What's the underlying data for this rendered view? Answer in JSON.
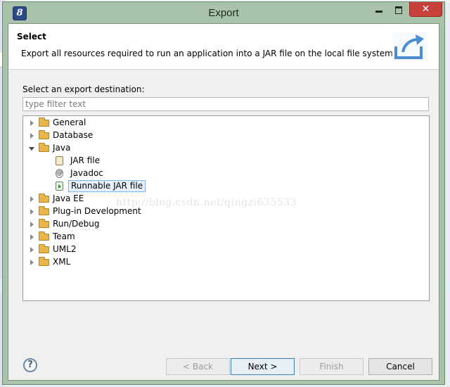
{
  "window": {
    "title": "Export",
    "close_glyph": "✕",
    "app_icon_glyph": "8"
  },
  "header": {
    "title": "Select",
    "description": "Export all resources required to run an application into a JAR file on the local file system.",
    "icon": "export-wizard-icon"
  },
  "destination_label": "Select an export destination:",
  "filter": {
    "placeholder": "type filter text",
    "value": ""
  },
  "tree": {
    "items": [
      {
        "label": "General",
        "type": "folder",
        "state": "collapsed"
      },
      {
        "label": "Database",
        "type": "folder",
        "state": "collapsed"
      },
      {
        "label": "Java",
        "type": "folder",
        "state": "expanded",
        "children": [
          {
            "label": "JAR file",
            "icon": "jar-icon"
          },
          {
            "label": "Javadoc",
            "icon": "javadoc-icon",
            "glyph": "@"
          },
          {
            "label": "Runnable JAR file",
            "icon": "runnable-jar-icon",
            "selected": true
          }
        ]
      },
      {
        "label": "Java EE",
        "type": "folder",
        "state": "collapsed"
      },
      {
        "label": "Plug-in Development",
        "type": "folder",
        "state": "collapsed"
      },
      {
        "label": "Run/Debug",
        "type": "folder",
        "state": "collapsed"
      },
      {
        "label": "Team",
        "type": "folder",
        "state": "collapsed"
      },
      {
        "label": "UML2",
        "type": "folder",
        "state": "collapsed"
      },
      {
        "label": "XML",
        "type": "folder",
        "state": "collapsed"
      }
    ]
  },
  "watermark": "http://blog.csdn.net/qingzi635533",
  "footer": {
    "help_glyph": "?",
    "back_label": "< Back",
    "next_label": "Next >",
    "finish_label": "Finish",
    "cancel_label": "Cancel"
  },
  "colors": {
    "window_frame": "#a8c3aa",
    "close_button": "#c7403a",
    "selection_border": "#3b7bd5"
  }
}
